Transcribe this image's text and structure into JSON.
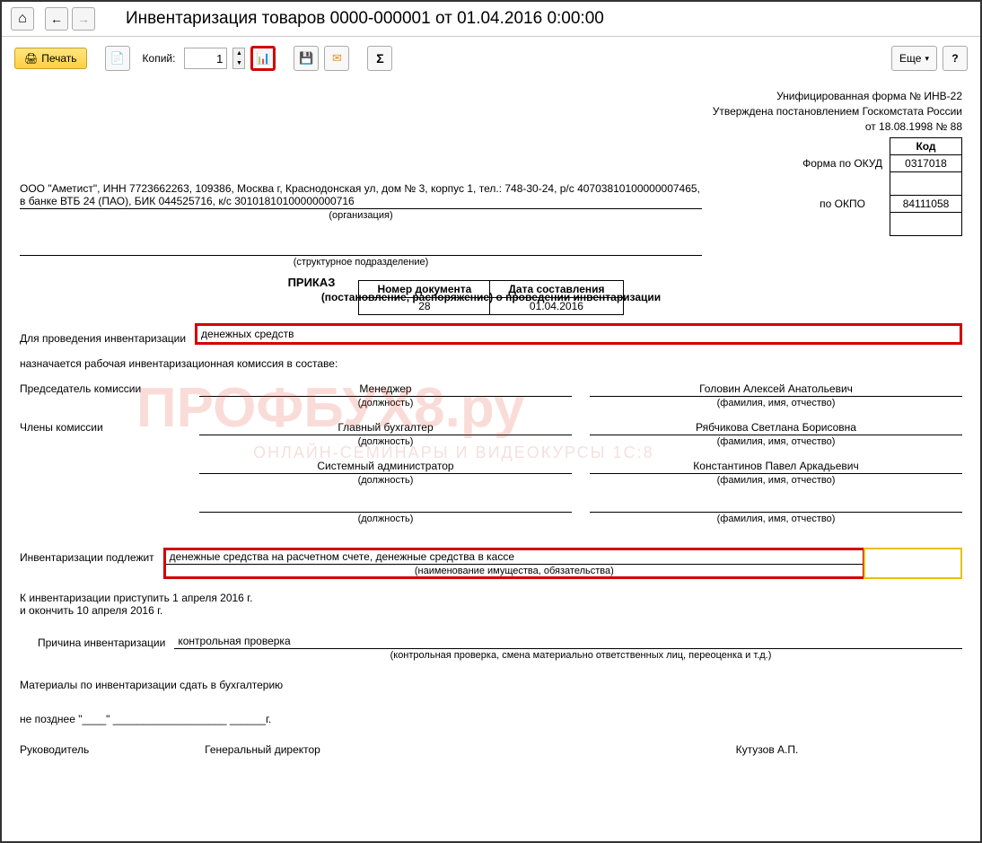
{
  "titlebar": {
    "title": "Инвентаризация товаров 0000-000001 от 01.04.2016 0:00:00"
  },
  "toolbar": {
    "print": "Печать",
    "copies_label": "Копий:",
    "copies_value": "1",
    "more": "Еще"
  },
  "doc": {
    "form_ref_1": "Унифицированная форма № ИНВ-22",
    "form_ref_2": "Утверждена постановлением Госкомстата России",
    "form_ref_3": "от 18.08.1998 № 88",
    "code_header": "Код",
    "okud_label": "Форма по ОКУД",
    "okud_value": "0317018",
    "okpo_label": "по ОКПО",
    "okpo_value": "84111058",
    "org_text": "ООО \"Аметист\", ИНН 7723662263, 109386, Москва г, Краснодонская ул, дом № 3, корпус 1, тел.: 748-30-24, р/с 40703810100000007465, в банке ВТБ 24 (ПАО), БИК 044525716, к/с 30101810100000000716",
    "org_sub": "(организация)",
    "unit_sub": "(структурное подразделение)",
    "docnum_h1": "Номер документа",
    "docnum_h2": "Дата составления",
    "docnum_v1": "28",
    "docnum_v2": "01.04.2016",
    "order_title": "ПРИКАЗ",
    "order_subtitle": "(постановление, распоряжение) о проведении инвентаризации",
    "inv_for_label": "Для проведения инвентаризации",
    "inv_for_value": "денежных средств",
    "commission_intro": "назначается рабочая инвентаризационная комиссия в составе:",
    "chairman_label": "Председатель комиссии",
    "members_label": "Члены комиссии",
    "pos_sub": "(должность)",
    "name_sub": "(фамилия, имя, отчество)",
    "chairman_pos": "Менеджер",
    "chairman_name": "Головин Алексей Анатольевич",
    "member1_pos": "Главный бухгалтер",
    "member1_name": "Рябчикова Светлана Борисовна",
    "member2_pos": "Системный администратор",
    "member2_name": "Константинов Павел Аркадьевич",
    "subject_label": "Инвентаризации подлежит",
    "subject_value": "денежные средства на расчетном счете, денежные средства в кассе",
    "subject_sub": "(наименование имущества, обязательства)",
    "start_line": "К инвентаризации приступить 1 апреля 2016 г.",
    "end_line": "и окончить 10 апреля 2016 г.",
    "reason_label": "Причина инвентаризации",
    "reason_value": "контрольная проверка",
    "reason_sub": "(контрольная проверка, смена материально ответственных лиц, переоценка и т.д.)",
    "materials_line": "Материалы по инвентаризации сдать в бухгалтерию",
    "deadline_prefix": "не позднее \"____\" ___________________ ______г.",
    "head_label": "Руководитель",
    "head_pos": "Генеральный директор",
    "head_name": "Кутузов А.П.",
    "watermark": "ПРОФБУХ8.ру",
    "watermark_sub": "ОНЛАЙН-СЕМИНАРЫ И ВИДЕОКУРСЫ 1С:8"
  }
}
